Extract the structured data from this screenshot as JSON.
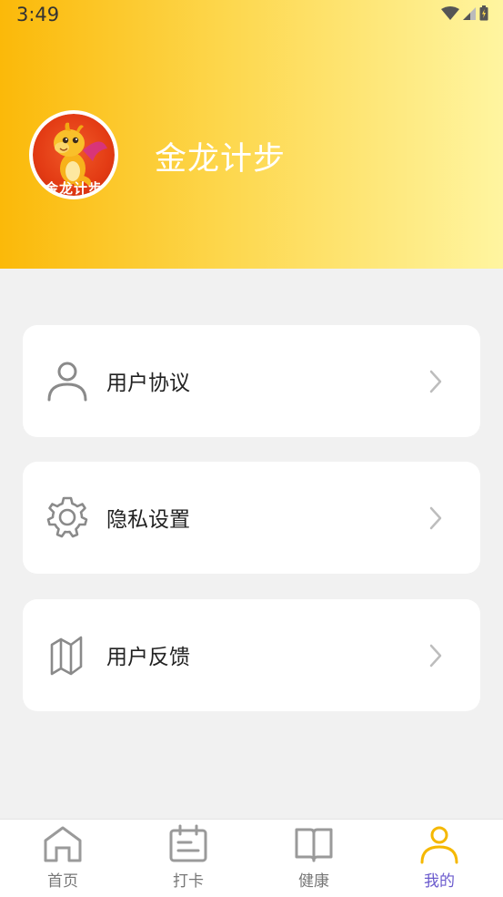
{
  "status_bar": {
    "time": "3:49",
    "icons": [
      "wifi-icon",
      "signal-icon",
      "battery-icon"
    ]
  },
  "profile": {
    "app_name": "金龙计步",
    "avatar_caption": "金龙计步"
  },
  "menu": {
    "items": [
      {
        "label": "用户协议",
        "icon": "user-icon"
      },
      {
        "label": "隐私设置",
        "icon": "gear-icon"
      },
      {
        "label": "用户反馈",
        "icon": "map-icon"
      }
    ]
  },
  "bottom_nav": {
    "items": [
      {
        "label": "首页",
        "icon": "home-icon",
        "active": false
      },
      {
        "label": "打卡",
        "icon": "calendar-icon",
        "active": false
      },
      {
        "label": "健康",
        "icon": "book-icon",
        "active": false
      },
      {
        "label": "我的",
        "icon": "person-icon",
        "active": true
      }
    ]
  },
  "colors": {
    "header_gradient_start": "#fbb909",
    "header_gradient_end": "#fff5a0",
    "active_icon": "#f5b800",
    "active_label": "#6a5acd",
    "inactive": "#9a9a9a"
  }
}
